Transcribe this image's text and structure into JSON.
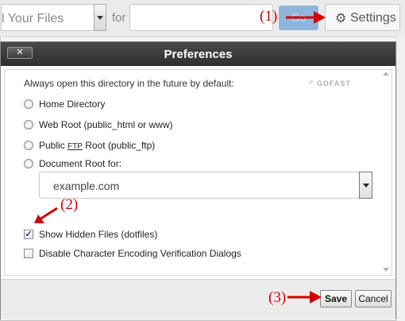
{
  "toolbar": {
    "scope_value": "l Your Files",
    "for_label": "for",
    "search_value": "",
    "go_label": "Go",
    "settings_label": "Settings"
  },
  "annotations": {
    "step1": "(1)",
    "step2": "(2)",
    "step3": "(3)",
    "color": "#d40000"
  },
  "dialog": {
    "close_label": "✕",
    "title": "Preferences",
    "prompt": "Always open this directory in the future by default:",
    "watermark": "GOFAST",
    "options": [
      {
        "label": "Home Directory"
      },
      {
        "label": "Web Root (public_html or www)"
      },
      {
        "pre": "Public ",
        "ftp": "FTP",
        "post": " Root (public_ftp)"
      },
      {
        "label": "Document Root for:"
      }
    ],
    "document_root_value": "example.com",
    "checkboxes": [
      {
        "label": "Show Hidden Files (dotfiles)",
        "checked": true
      },
      {
        "label": "Disable Character Encoding Verification Dialogs",
        "checked": false
      }
    ],
    "save_label": "Save",
    "cancel_label": "Cancel"
  },
  "icons": {
    "gear": "gear-icon",
    "dropdown": "chevron-down-icon",
    "close": "close-icon"
  }
}
